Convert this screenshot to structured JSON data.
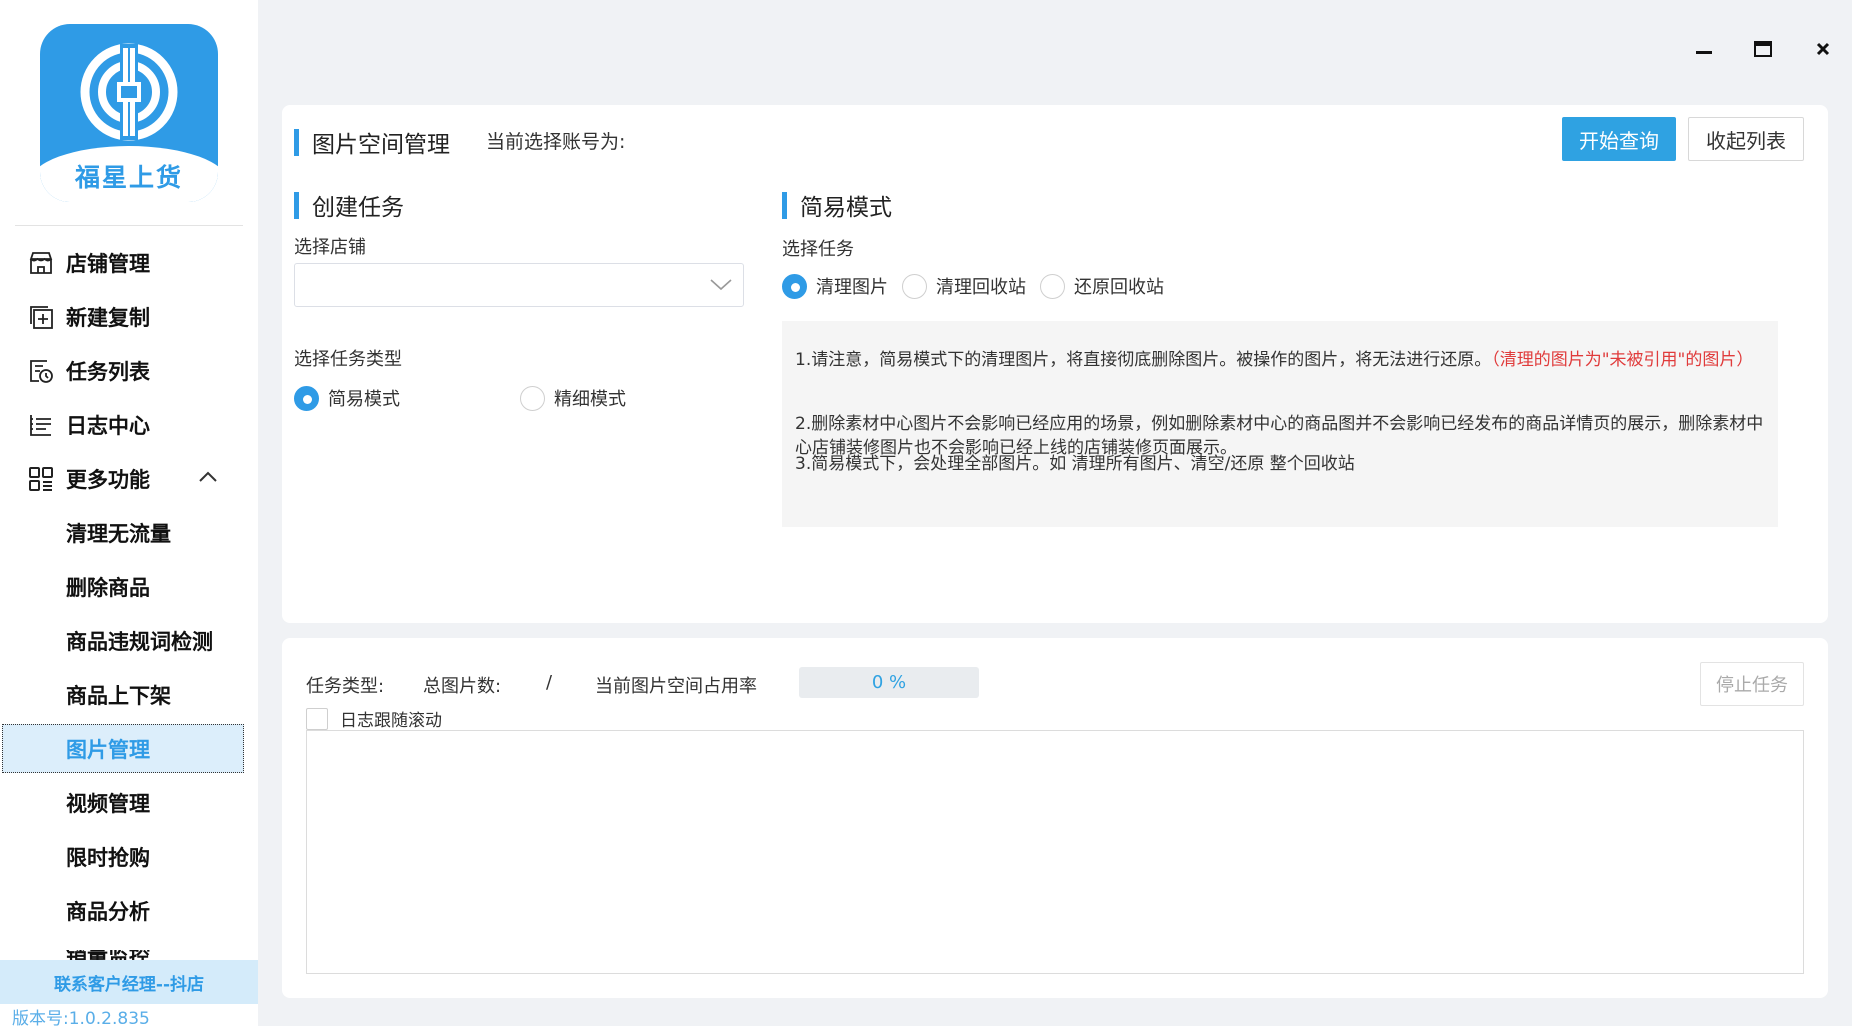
{
  "app": {
    "logo_text": "福星上货",
    "version": "版本号:1.0.2.835",
    "contact": "联系客户经理--抖店"
  },
  "sidebar": {
    "items": [
      {
        "label": "店铺管理",
        "icon": "store-icon"
      },
      {
        "label": "新建复制",
        "icon": "add-copy-icon"
      },
      {
        "label": "任务列表",
        "icon": "task-list-icon"
      },
      {
        "label": "日志中心",
        "icon": "log-icon"
      },
      {
        "label": "更多功能",
        "icon": "more-apps-icon",
        "expanded": true
      }
    ],
    "sub_items": [
      {
        "label": "清理无流量"
      },
      {
        "label": "删除商品"
      },
      {
        "label": "商品违规词检测"
      },
      {
        "label": "商品上下架"
      },
      {
        "label": "图片管理",
        "active": true
      },
      {
        "label": "视频管理"
      },
      {
        "label": "限时抢购"
      },
      {
        "label": "商品分析"
      },
      {
        "label": "销量监控"
      }
    ]
  },
  "header": {
    "title": "图片空间管理",
    "account_label": "当前选择账号为:",
    "start_query": "开始查询",
    "collapse_list": "收起列表"
  },
  "create_task": {
    "title": "创建任务",
    "store_label": "选择店铺",
    "store_value": "",
    "task_type_label": "选择任务类型",
    "modes": [
      {
        "label": "简易模式",
        "checked": true
      },
      {
        "label": "精细模式",
        "checked": false
      }
    ]
  },
  "simple_mode": {
    "title": "简易模式",
    "task_label": "选择任务",
    "tasks": [
      {
        "label": "清理图片",
        "checked": true
      },
      {
        "label": "清理回收站",
        "checked": false
      },
      {
        "label": "还原回收站",
        "checked": false
      }
    ],
    "notes": {
      "n1": "1.请注意，简易模式下的清理图片，将直接彻底删除图片。被操作的图片，将无法进行还原。",
      "n1_red": "（清理的图片为\"未被引用\"的图片）",
      "n2": "2.删除素材中心图片不会影响已经应用的场景，例如删除素材中心的商品图并不会影响已经发布的商品详情页的展示，删除素材中心店铺装修图片也不会影响已经上线的店铺装修页面展示。",
      "n3": "3.简易模式下，会处理全部图片。如 清理所有图片、清空/还原 整个回收站"
    }
  },
  "status": {
    "task_type_label": "任务类型:",
    "total_images_label": "总图片数:",
    "separator": "/",
    "usage_label": "当前图片空间占用率",
    "usage_value": "0 %",
    "usage_fraction": 0,
    "stop_task": "停止任务",
    "follow_scroll": "日志跟随滚动"
  },
  "colors": {
    "accent": "#2f9be6",
    "warning": "#e03b3b"
  }
}
